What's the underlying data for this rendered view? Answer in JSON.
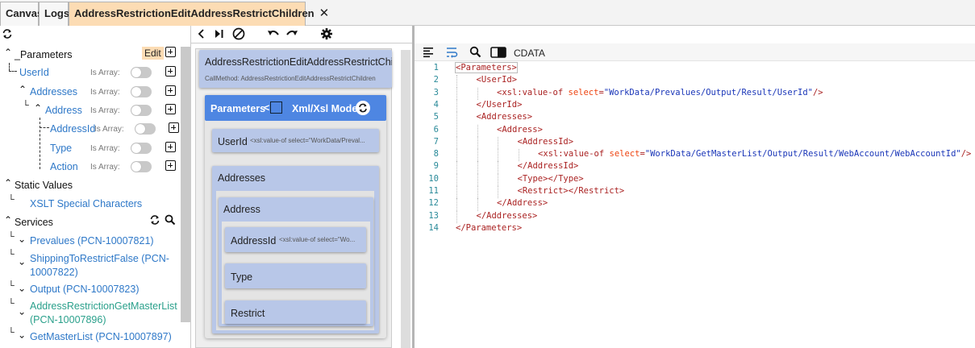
{
  "tabs": [
    {
      "label": "Canvas"
    },
    {
      "label": "Logs"
    },
    {
      "label": "AddressRestrictionEditAddressRestrictChildren",
      "active": true
    }
  ],
  "left": {
    "parameters_label": "_Parameters",
    "edit_label": "Edit",
    "is_array_label": "Is Array:",
    "params": [
      {
        "label": "UserId",
        "is_array": false
      },
      {
        "label": "Addresses",
        "is_array": false
      },
      {
        "label": "Address",
        "is_array": false
      },
      {
        "label": "AddressId",
        "is_array": false
      },
      {
        "label": "Type",
        "is_array": false
      },
      {
        "label": "Action",
        "is_array": false
      }
    ],
    "static_values_label": "Static Values",
    "static_items": [
      "XSLT Special Characters"
    ],
    "services_label": "Services",
    "services": [
      {
        "label": "Prevalues (PCN-10007821)",
        "color": "blue"
      },
      {
        "label_line1": "ShippingToRestrictFalse (PCN-",
        "label_line2": "10007822)",
        "color": "blue"
      },
      {
        "label": "Output (PCN-10007823)",
        "color": "blue"
      },
      {
        "label_line1": "AddressRestrictionGetMasterList",
        "label_line2": "(PCN-10007896)",
        "color": "teal"
      },
      {
        "label": "GetMasterList (PCN-10007897)",
        "color": "blue"
      }
    ]
  },
  "middle": {
    "title": "AddressRestrictionEditAddressRestrictChild",
    "call_method": "CallMethod: AddressRestrictionEditAddressRestrictChildren",
    "params_bar_label": "Parameters",
    "params_bar_arrow": "<",
    "mode_label": "Xml/Xsl Mode",
    "cards": {
      "userid_label": "UserId",
      "userid_value": "<xsl:value-of select=\"WorkData/Preval...",
      "addresses_label": "Addresses",
      "address_label": "Address",
      "addressid_label": "AddressId",
      "addressid_value": "<xsl:value-of select=\"Wo...",
      "type_label": "Type",
      "restrict_label": "Restrict"
    }
  },
  "code": {
    "cdata_label": "CDATA",
    "lines": [
      {
        "n": "1",
        "indent": 0,
        "html": "<span class='tagc'>&lt;Parameters&gt;</span>"
      },
      {
        "n": "2",
        "indent": 1,
        "html": "<span class='tagc'>&lt;UserId&gt;</span>"
      },
      {
        "n": "3",
        "indent": 2,
        "html": "<span class='tagc'>&lt;xsl:value-of </span><span class='attr'>select</span><span class='tagc'>=</span><span class='val'>\"WorkData/Prevalues/Output/Result/UserId\"</span><span class='tagc'>/&gt;</span>"
      },
      {
        "n": "4",
        "indent": 1,
        "html": "<span class='tagc'>&lt;/UserId&gt;</span>"
      },
      {
        "n": "5",
        "indent": 1,
        "html": "<span class='tagc'>&lt;Addresses&gt;</span>"
      },
      {
        "n": "6",
        "indent": 2,
        "html": "<span class='tagc'>&lt;Address&gt;</span>"
      },
      {
        "n": "7",
        "indent": 3,
        "html": "<span class='tagc'>&lt;AddressId&gt;</span>"
      },
      {
        "n": "8",
        "indent": 4,
        "html": "<span class='tagc'>&lt;xsl:value-of </span><span class='attr'>select</span><span class='tagc'>=</span><span class='val'>\"WorkData/GetMasterList/Output/Result/WebAccount/WebAccountId\"</span><span class='tagc'>/&gt;</span>"
      },
      {
        "n": "9",
        "indent": 3,
        "html": "<span class='tagc'>&lt;/AddressId&gt;</span>"
      },
      {
        "n": "10",
        "indent": 3,
        "html": "<span class='tagc'>&lt;Type&gt;&lt;/Type&gt;</span>"
      },
      {
        "n": "11",
        "indent": 3,
        "html": "<span class='tagc'>&lt;Restrict&gt;&lt;/Restrict&gt;</span>"
      },
      {
        "n": "12",
        "indent": 2,
        "html": "<span class='tagc'>&lt;/Address&gt;</span>"
      },
      {
        "n": "13",
        "indent": 1,
        "html": "<span class='tagc'>&lt;/Addresses&gt;</span>"
      },
      {
        "n": "14",
        "indent": 0,
        "html": "<span class='tagc'>&lt;/Parameters&gt;</span>"
      }
    ]
  },
  "colors": {
    "accent_blue": "#4e86e2",
    "active_tab": "#fcdcb4",
    "link_blue": "#2e78c8",
    "teal": "#2aa08b"
  }
}
